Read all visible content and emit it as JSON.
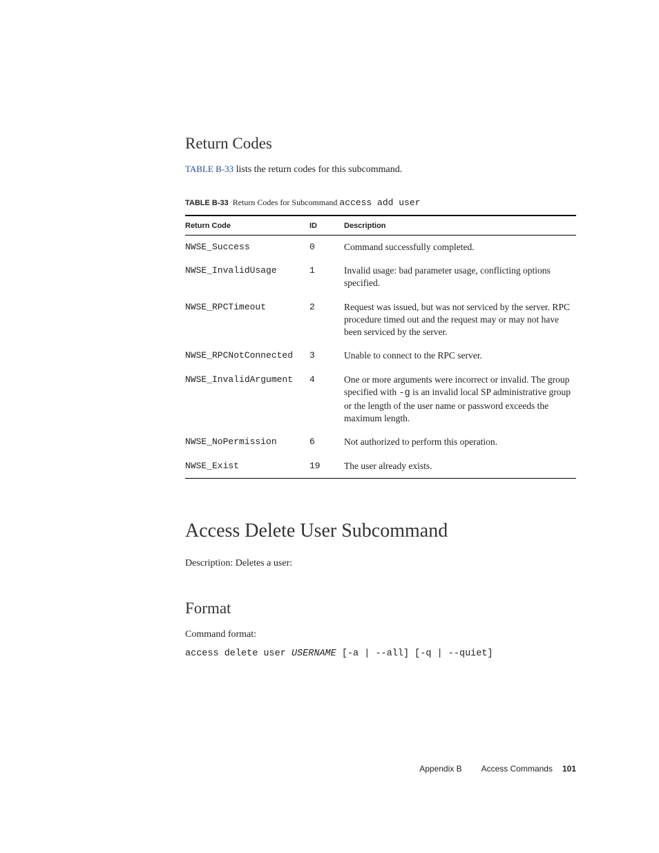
{
  "section1": {
    "heading": "Return Codes",
    "intro_link": "TABLE B-33",
    "intro_rest": " lists the return codes for this subcommand."
  },
  "table": {
    "caption_label": "TABLE B-33",
    "caption_text_1": "Return Codes for Subcommand ",
    "caption_mono": "access add user",
    "headers": {
      "c1": "Return Code",
      "c2": "ID",
      "c3": "Description"
    },
    "rows": [
      {
        "code": "NWSE_Success",
        "id": "0",
        "desc": "Command successfully completed."
      },
      {
        "code": "NWSE_InvalidUsage",
        "id": "1",
        "desc": "Invalid usage: bad parameter usage, conflicting options specified."
      },
      {
        "code": "NWSE_RPCTimeout",
        "id": "2",
        "desc": "Request was issued, but was not serviced by the server. RPC procedure timed out and the request may or may not have been serviced by the server."
      },
      {
        "code": "NWSE_RPCNotConnected",
        "id": "3",
        "desc": "Unable to connect to the RPC server."
      },
      {
        "code": "NWSE_InvalidArgument",
        "id": "4",
        "desc_pre": "One or more arguments were incorrect or invalid. The group specified with ",
        "desc_mono": "-g",
        "desc_post": " is an invalid local SP administrative group or the length of the user name or password exceeds the maximum length."
      },
      {
        "code": "NWSE_NoPermission",
        "id": "6",
        "desc": "Not authorized to perform this operation."
      },
      {
        "code": "NWSE_Exist",
        "id": "19",
        "desc": "The user already exists."
      }
    ]
  },
  "section2": {
    "heading": "Access Delete User Subcommand",
    "description": "Description: Deletes a user:"
  },
  "section3": {
    "heading": "Format",
    "label": "Command format:",
    "cmd_pre": "access delete user ",
    "cmd_ital": "USERNAME",
    "cmd_post": " [-a | --all] [-q | --quiet]"
  },
  "footer": {
    "appendix": "Appendix B",
    "title": "Access Commands",
    "page": "101"
  }
}
